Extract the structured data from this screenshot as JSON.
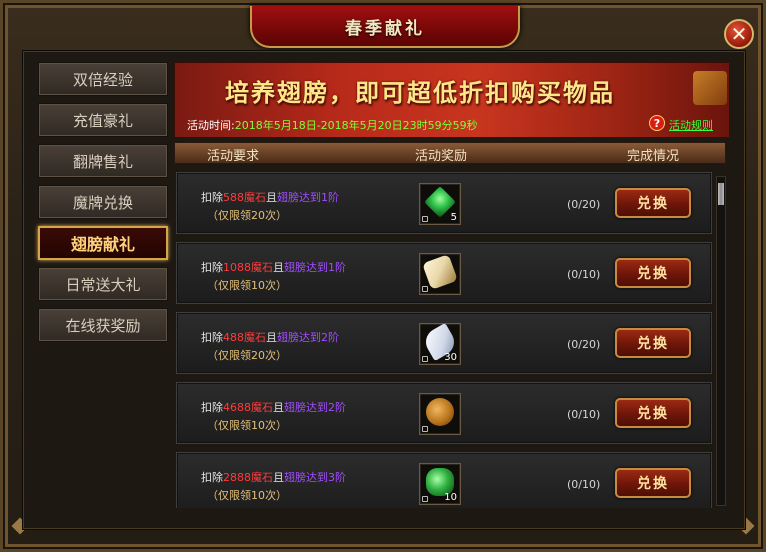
{
  "window": {
    "title": "春季献礼",
    "close_label": "✕"
  },
  "sidebar": {
    "items": [
      {
        "label": "双倍经验"
      },
      {
        "label": "充值豪礼"
      },
      {
        "label": "翻牌售礼"
      },
      {
        "label": "魔牌兑换"
      },
      {
        "label": "翅膀献礼",
        "active": true
      },
      {
        "label": "日常送大礼"
      },
      {
        "label": "在线获奖励"
      }
    ]
  },
  "banner": {
    "slogan": "培养翅膀，即可超低折扣购买物品",
    "time_label": "活动时间:",
    "time_value": "2018年5月18日-2018年5月20日23时59分59秒",
    "help_icon": "?",
    "rules_link": "活动规则"
  },
  "table": {
    "headers": {
      "requirement": "活动要求",
      "reward": "活动奖励",
      "status": "完成情况"
    }
  },
  "rows": [
    {
      "prefix": "扣除",
      "cost": "588魔石",
      "and": "且",
      "wing": "翅膀达到1阶",
      "limit": "（仅限领20次）",
      "item_icon": "green-gem-icon",
      "item_color": "#2fc04a",
      "qty": "5",
      "progress": "(0/20)",
      "button": "兑换"
    },
    {
      "prefix": "扣除",
      "cost": "1088魔石",
      "and": "且",
      "wing": "翅膀达到1阶",
      "limit": "（仅限领10次）",
      "item_icon": "scroll-token-icon",
      "item_color": "#e8d7a8",
      "qty": "",
      "progress": "(0/10)",
      "button": "兑换"
    },
    {
      "prefix": "扣除",
      "cost": "488魔石",
      "and": "且",
      "wing": "翅膀达到2阶",
      "limit": "（仅限领20次）",
      "item_icon": "white-feather-icon",
      "item_color": "#e8eef8",
      "qty": "30",
      "progress": "(0/20)",
      "button": "兑换"
    },
    {
      "prefix": "扣除",
      "cost": "4688魔石",
      "and": "且",
      "wing": "翅膀达到2阶",
      "limit": "（仅限领10次）",
      "item_icon": "bronze-coin-icon",
      "item_color": "#b8741c",
      "qty": "",
      "progress": "(0/10)",
      "button": "兑换"
    },
    {
      "prefix": "扣除",
      "cost": "2888魔石",
      "and": "且",
      "wing": "翅膀达到3阶",
      "limit": "（仅限领10次）",
      "item_icon": "green-gem-icon",
      "item_color": "#2fb040",
      "qty": "10",
      "progress": "(0/10)",
      "button": "兑换"
    }
  ]
}
